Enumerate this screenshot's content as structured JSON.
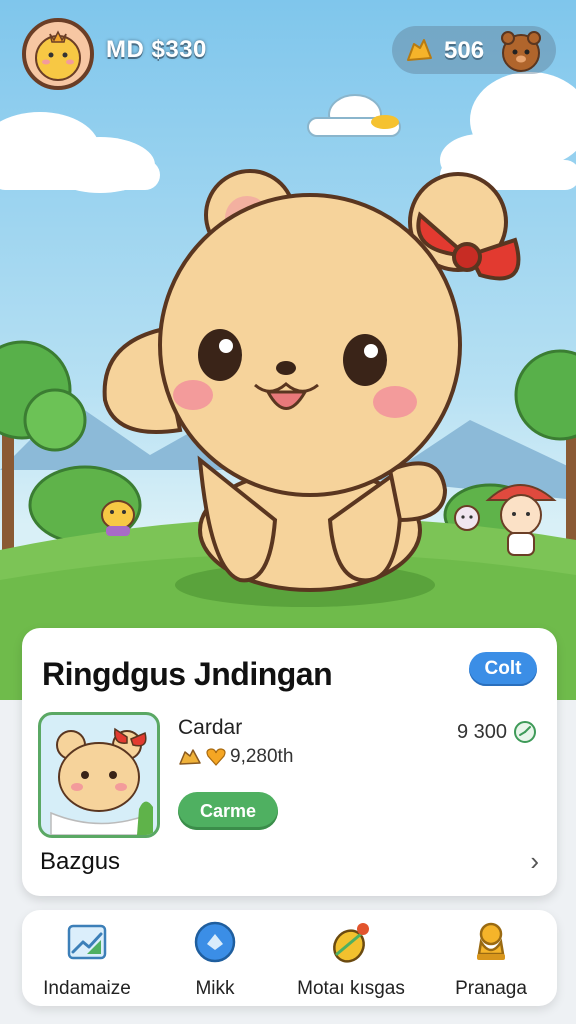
{
  "hud": {
    "money": "MD $330",
    "count": "506",
    "avatar_icon": "chick-avatar-icon",
    "coin_icon": "gold-nugget-icon",
    "pet_icon": "brown-pet-icon"
  },
  "card": {
    "title": "Ringdgus Jndingan",
    "badge": "Colt",
    "item": {
      "name": "Cardar",
      "stats": "9,280th",
      "price": "9 300",
      "button": "Carme"
    },
    "footer": "Bazgus"
  },
  "nav": {
    "items": [
      {
        "label": "Indamaize",
        "icon": "chart-icon"
      },
      {
        "label": "Mikk",
        "icon": "blue-orb-icon"
      },
      {
        "label": "Motaı kısgas",
        "icon": "seed-leaf-icon"
      },
      {
        "label": "Pranaga",
        "icon": "trophy-icon"
      }
    ]
  },
  "colors": {
    "sky": "#7fc6ec",
    "grass": "#7cc456",
    "badge": "#3b8ee6",
    "action": "#4fb061"
  }
}
